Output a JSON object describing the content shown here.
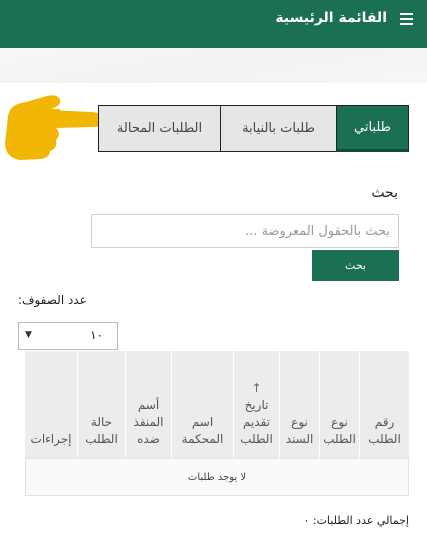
{
  "header": {
    "title": "القائمة الرئيسية",
    "menu_icon": "hamburger-icon",
    "bg": "#1b6f52"
  },
  "tabs": [
    {
      "label": "طلباتي",
      "active": true
    },
    {
      "label": "طلبات بالنيابة",
      "active": false
    },
    {
      "label": "الطلبات المحالة",
      "active": false
    }
  ],
  "pointer_icon": "pointing-hand-icon",
  "search": {
    "label": "بحث",
    "placeholder": "بحث بالحقول المعروضة ...",
    "button": "بحث"
  },
  "rows": {
    "label": "عدد الصفوف:",
    "selected": "١٠"
  },
  "table": {
    "sort_icon": "↑",
    "columns": [
      {
        "lines": [
          "رقم",
          "الطلب"
        ]
      },
      {
        "lines": [
          "نوع",
          "الطلب"
        ]
      },
      {
        "lines": [
          "نوع",
          "السند"
        ]
      },
      {
        "lines": [
          "تاريخ",
          "تقديم",
          "الطلب"
        ],
        "sorted": true
      },
      {
        "lines": [
          "اسم",
          "المحكمة"
        ]
      },
      {
        "lines": [
          "أسم",
          "المنفذ",
          "ضده"
        ]
      },
      {
        "lines": [
          "حالة",
          "الطلب"
        ]
      },
      {
        "lines": [
          "إجراءات"
        ]
      }
    ],
    "empty_text": "لا يوجد طلبات"
  },
  "total": {
    "label": "إجمالي عدد الطلبات: ٠"
  }
}
